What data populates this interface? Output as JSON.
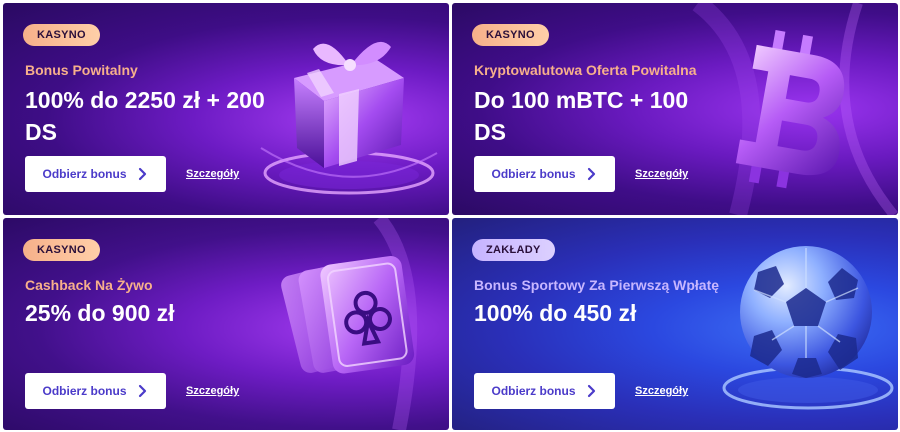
{
  "colors": {
    "cta_text": "#4b3bc9",
    "badge_orange": "#f6b08a",
    "badge_lilac": "#c6b3ff",
    "subtitle_orange": "#f7b08b",
    "subtitle_lilac": "#c7b6ff"
  },
  "cards": [
    {
      "badge": "KASYNO",
      "subtitle": "Bonus Powitalny",
      "headline": "100% do 2250 zł + 200 DS",
      "cta": "Odbierz bonus",
      "details": "Szczegóły",
      "art_icon": "gift-box-icon"
    },
    {
      "badge": "KASYNO",
      "subtitle": "Kryptowalutowa Oferta Powitalna",
      "headline": "Do 100 mBTC + 100 DS",
      "cta": "Odbierz bonus",
      "details": "Szczegóły",
      "art_icon": "bitcoin-icon"
    },
    {
      "badge": "KASYNO",
      "subtitle": "Cashback Na Żywo",
      "headline": "25% do 900 zł",
      "cta": "Odbierz bonus",
      "details": "Szczegóły",
      "art_icon": "playing-cards-icon"
    },
    {
      "badge": "ZAKŁADY",
      "subtitle": "Bonus Sportowy Za Pierwszą Wpłatę",
      "headline": "100% do 450 zł",
      "cta": "Odbierz bonus",
      "details": "Szczegóły",
      "art_icon": "soccer-ball-icon"
    }
  ]
}
